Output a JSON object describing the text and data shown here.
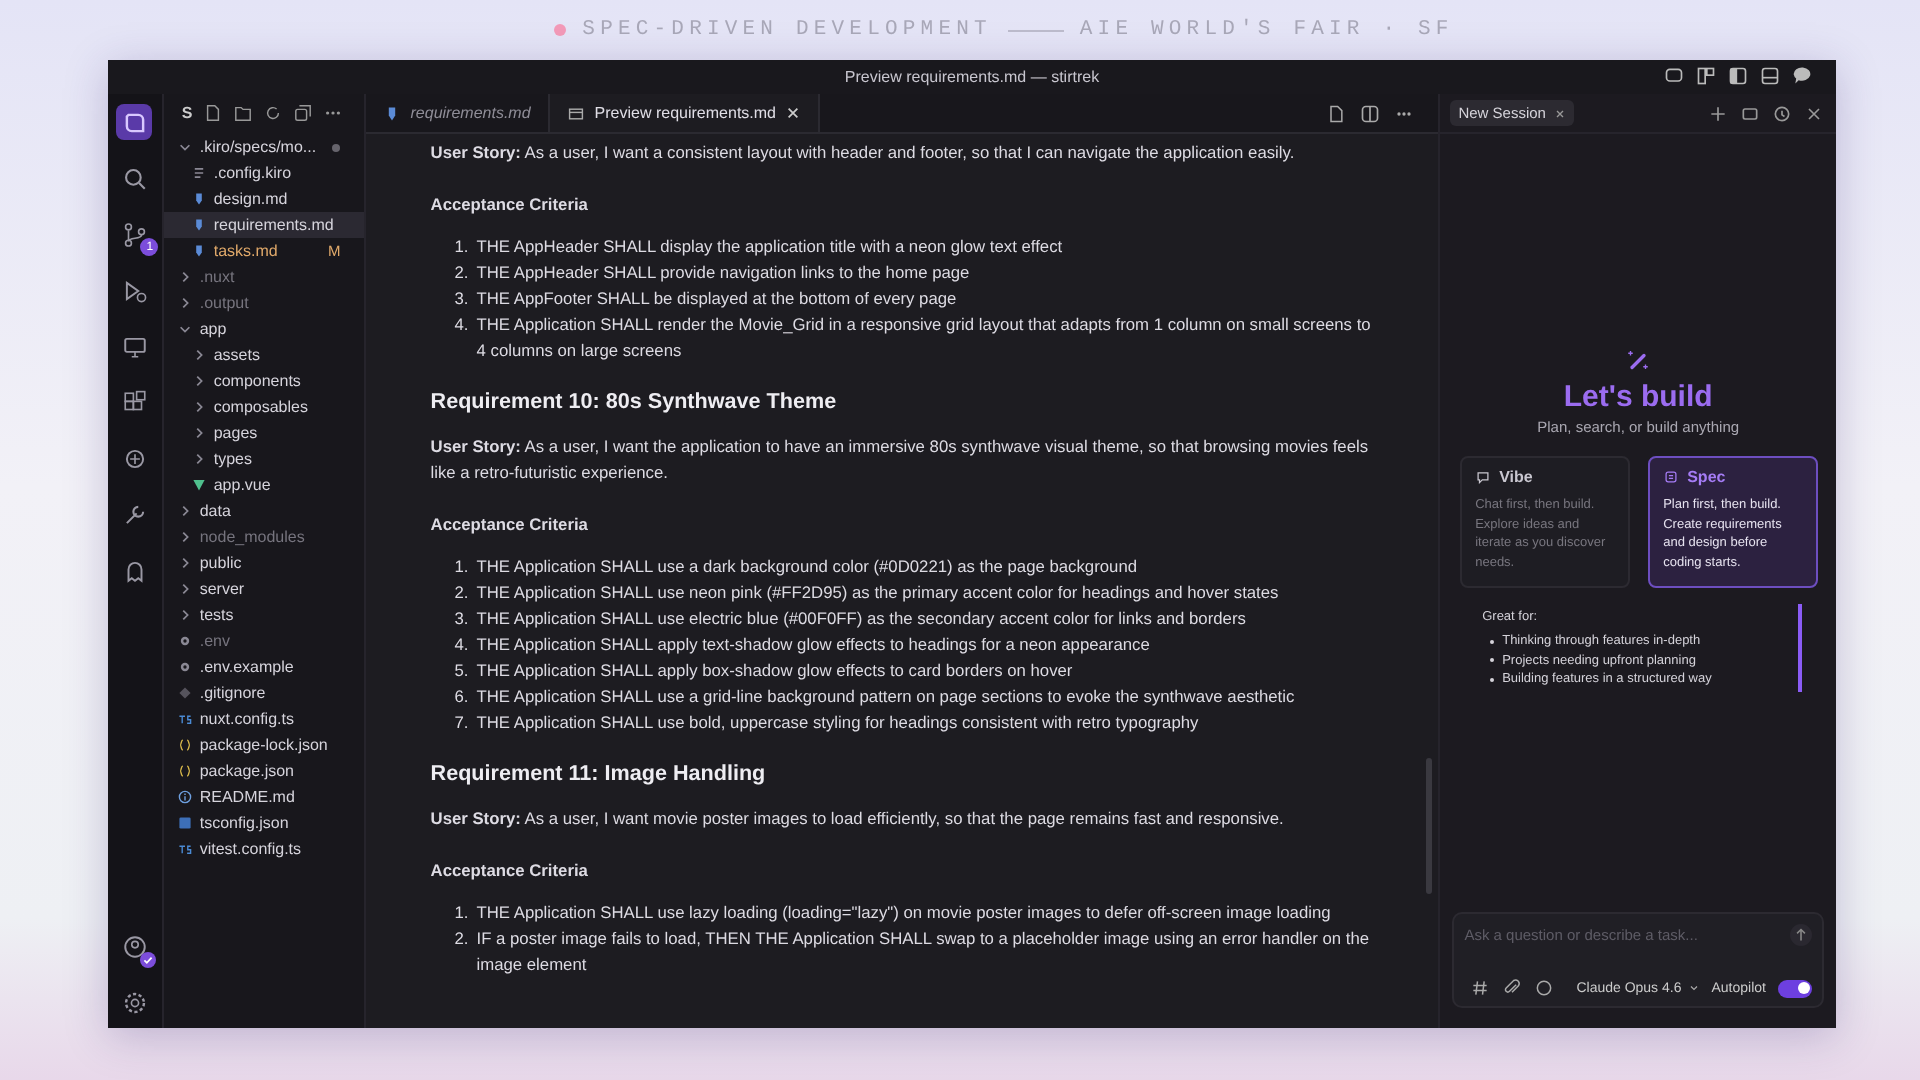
{
  "banner": {
    "left": "SPEC-DRIVEN DEVELOPMENT",
    "right": "AIE WORLD'S FAIR · SF"
  },
  "window": {
    "title": "Preview requirements.md — stirtrek"
  },
  "activity_bar": {
    "top": [
      {
        "kind": "logo",
        "selected": true
      },
      {
        "kind": "search",
        "selected": false
      },
      {
        "kind": "branch",
        "selected": false,
        "badge": "1"
      },
      {
        "kind": "debug",
        "selected": false
      },
      {
        "kind": "remote",
        "selected": false
      },
      {
        "kind": "extensions",
        "selected": false
      },
      {
        "kind": "bug",
        "selected": false
      },
      {
        "kind": "tool",
        "selected": false
      },
      {
        "kind": "ghost",
        "selected": false
      }
    ],
    "bottom": [
      {
        "kind": "account",
        "check_badge": true
      },
      {
        "kind": "settings",
        "check_badge": false
      }
    ]
  },
  "explorer": {
    "header": "S",
    "tree": [
      {
        "label": ".kiro/specs/mo...",
        "kind": "folder",
        "expanded": true,
        "dimmed": false,
        "selected": false,
        "changed": true,
        "children": [
          {
            "label": ".config.kiro",
            "kind": "config",
            "dimmed": false,
            "selected": false
          },
          {
            "label": "design.md",
            "kind": "md",
            "dimmed": false,
            "selected": false
          },
          {
            "label": "requirements.md",
            "kind": "md",
            "dimmed": false,
            "selected": true
          },
          {
            "label": "tasks.md",
            "kind": "md",
            "dimmed": false,
            "selected": false,
            "status": "M"
          }
        ]
      },
      {
        "label": ".nuxt",
        "kind": "folder",
        "expanded": false,
        "dimmed": true,
        "selected": false
      },
      {
        "label": ".output",
        "kind": "folder",
        "expanded": false,
        "dimmed": true,
        "selected": false
      },
      {
        "label": "app",
        "kind": "folder",
        "expanded": true,
        "dimmed": false,
        "selected": false,
        "children": [
          {
            "label": "assets",
            "kind": "folder",
            "expanded": false,
            "dimmed": false,
            "selected": false
          },
          {
            "label": "components",
            "kind": "folder",
            "expanded": false,
            "dimmed": false,
            "selected": false
          },
          {
            "label": "composables",
            "kind": "folder",
            "expanded": false,
            "dimmed": false,
            "selected": false
          },
          {
            "label": "pages",
            "kind": "folder",
            "expanded": false,
            "dimmed": false,
            "selected": false
          },
          {
            "label": "types",
            "kind": "folder",
            "expanded": false,
            "dimmed": false,
            "selected": false
          },
          {
            "label": "app.vue",
            "kind": "vue",
            "dimmed": false,
            "selected": false
          }
        ]
      },
      {
        "label": "data",
        "kind": "folder",
        "expanded": false,
        "dimmed": false,
        "selected": false
      },
      {
        "label": "node_modules",
        "kind": "folder",
        "expanded": false,
        "dimmed": true,
        "selected": false
      },
      {
        "label": "public",
        "kind": "folder",
        "expanded": false,
        "dimmed": false,
        "selected": false
      },
      {
        "label": "server",
        "kind": "folder",
        "expanded": false,
        "dimmed": false,
        "selected": false
      },
      {
        "label": "tests",
        "kind": "folder",
        "expanded": false,
        "dimmed": false,
        "selected": false
      },
      {
        "label": ".env",
        "kind": "env",
        "dimmed": true,
        "selected": false
      },
      {
        "label": ".env.example",
        "kind": "env",
        "dimmed": false,
        "selected": false
      },
      {
        "label": ".gitignore",
        "kind": "git",
        "dimmed": false,
        "selected": false
      },
      {
        "label": "nuxt.config.ts",
        "kind": "ts",
        "dimmed": false,
        "selected": false
      },
      {
        "label": "package-lock.json",
        "kind": "json",
        "dimmed": false,
        "selected": false
      },
      {
        "label": "package.json",
        "kind": "json",
        "dimmed": false,
        "selected": false
      },
      {
        "label": "README.md",
        "kind": "info",
        "dimmed": false,
        "selected": false
      },
      {
        "label": "tsconfig.json",
        "kind": "tsconfig",
        "dimmed": false,
        "selected": false
      },
      {
        "label": "vitest.config.ts",
        "kind": "ts",
        "dimmed": false,
        "selected": false
      }
    ]
  },
  "tabs": [
    {
      "label": "requirements.md",
      "selected": false,
      "italic": true
    },
    {
      "label": "Preview requirements.md",
      "selected": true,
      "italic": false
    }
  ],
  "document": [
    {
      "kind": "story",
      "text": "**User Story:** As a user, I want a consistent layout with header and footer, so that I can navigate the application easily."
    },
    {
      "kind": "subheading",
      "text": "Acceptance Criteria"
    },
    {
      "kind": "list",
      "items": [
        {
          "number": "1.",
          "text": "THE AppHeader SHALL display the application title with a neon glow text effect"
        },
        {
          "number": "2.",
          "text": "THE AppHeader SHALL provide navigation links to the home page"
        },
        {
          "number": "3.",
          "text": "THE AppFooter SHALL be displayed at the bottom of every page"
        },
        {
          "number": "4.",
          "text": "THE Application SHALL render the Movie_Grid in a responsive grid layout that adapts from 1 column on small screens to 4 columns on large screens"
        }
      ]
    },
    {
      "kind": "heading",
      "text": "Requirement 10: 80s Synthwave Theme"
    },
    {
      "kind": "story",
      "text": "**User Story:** As a user, I want the application to have an immersive 80s synthwave visual theme, so that browsing movies feels like a retro-futuristic experience."
    },
    {
      "kind": "subheading",
      "text": "Acceptance Criteria"
    },
    {
      "kind": "list",
      "items": [
        {
          "number": "1.",
          "text": "THE Application SHALL use a dark background color (#0D0221) as the page background"
        },
        {
          "number": "2.",
          "text": "THE Application SHALL use neon pink (#FF2D95) as the primary accent color for headings and hover states"
        },
        {
          "number": "3.",
          "text": "THE Application SHALL use electric blue (#00F0FF) as the secondary accent color for links and borders"
        },
        {
          "number": "4.",
          "text": "THE Application SHALL apply text-shadow glow effects to headings for a neon appearance"
        },
        {
          "number": "5.",
          "text": "THE Application SHALL apply box-shadow glow effects to card borders on hover"
        },
        {
          "number": "6.",
          "text": "THE Application SHALL use a grid-line background pattern on page sections to evoke the synthwave aesthetic"
        },
        {
          "number": "7.",
          "text": "THE Application SHALL use bold, uppercase styling for headings consistent with retro typography"
        }
      ]
    },
    {
      "kind": "heading",
      "text": "Requirement 11: Image Handling"
    },
    {
      "kind": "story",
      "text": "**User Story:** As a user, I want movie poster images to load efficiently, so that the page remains fast and responsive."
    },
    {
      "kind": "subheading",
      "text": "Acceptance Criteria"
    },
    {
      "kind": "list",
      "items": [
        {
          "number": "1.",
          "text": "THE Application SHALL use lazy loading (loading=\"lazy\") on movie poster images to defer off-screen image loading"
        },
        {
          "number": "2.",
          "text": "IF a poster image fails to load, THEN THE Application SHALL swap to a placeholder image using an error handler on the image element"
        }
      ]
    }
  ],
  "chat": {
    "tab": "New Session",
    "title": "Let's build",
    "subtitle": "Plan, search, or build anything",
    "modes": [
      {
        "name": "Vibe",
        "description": "Chat first, then build. Explore ideas and iterate as you discover needs.",
        "selected": false
      },
      {
        "name": "Spec",
        "description": "Plan first, then build. Create requirements and design before coding starts.",
        "selected": true
      }
    ],
    "great_for": {
      "title": "Great for:",
      "items": [
        "Thinking through features in-depth",
        "Projects needing upfront planning",
        "Building features in a structured way"
      ]
    },
    "input": {
      "placeholder": "Ask a question or describe a task..."
    },
    "model": "Claude Opus 4.6",
    "autopilot": {
      "label": "Autopilot",
      "on": true
    }
  }
}
